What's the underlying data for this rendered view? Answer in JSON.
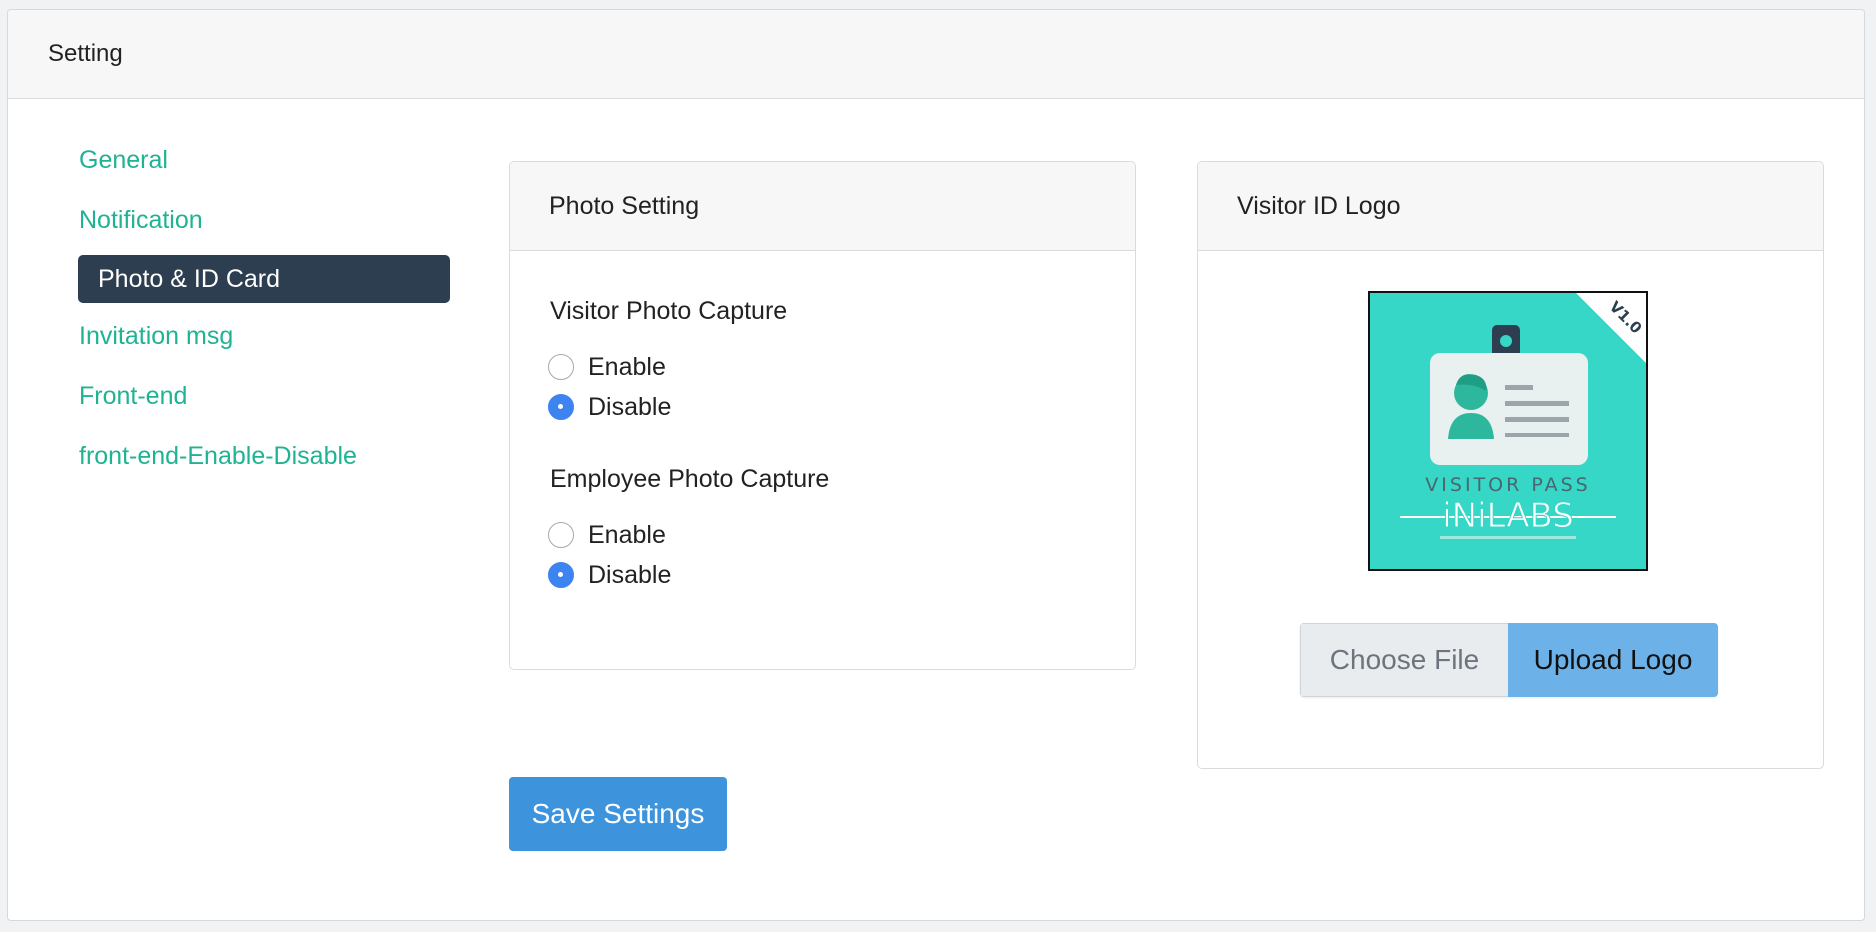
{
  "card": {
    "title": "Setting"
  },
  "nav": {
    "items": [
      {
        "label": "General",
        "active": false
      },
      {
        "label": "Notification",
        "active": false
      },
      {
        "label": "Photo & ID Card",
        "active": true
      },
      {
        "label": "Invitation msg",
        "active": false
      },
      {
        "label": "Front-end",
        "active": false
      },
      {
        "label": "front-end-Enable-Disable",
        "active": false
      }
    ]
  },
  "photo_setting": {
    "title": "Photo Setting",
    "visitor": {
      "label": "Visitor Photo Capture",
      "options": [
        "Enable",
        "Disable"
      ],
      "selected": "Disable"
    },
    "employee": {
      "label": "Employee Photo Capture",
      "options": [
        "Enable",
        "Disable"
      ],
      "selected": "Disable"
    }
  },
  "visitor_logo": {
    "title": "Visitor ID Logo",
    "logo_alt": "VISITOR PASS iNiLABS",
    "choose_file_label": "Choose File",
    "upload_label": "Upload Logo"
  },
  "save_label": "Save Settings",
  "colors": {
    "accent_green": "#1fb393",
    "nav_active_bg": "#2c3e50",
    "radio_checked": "#3d84f0",
    "save_button": "#3d94dc",
    "upload_button": "#6cb2e8",
    "logo_bg": "#36d7c6"
  }
}
